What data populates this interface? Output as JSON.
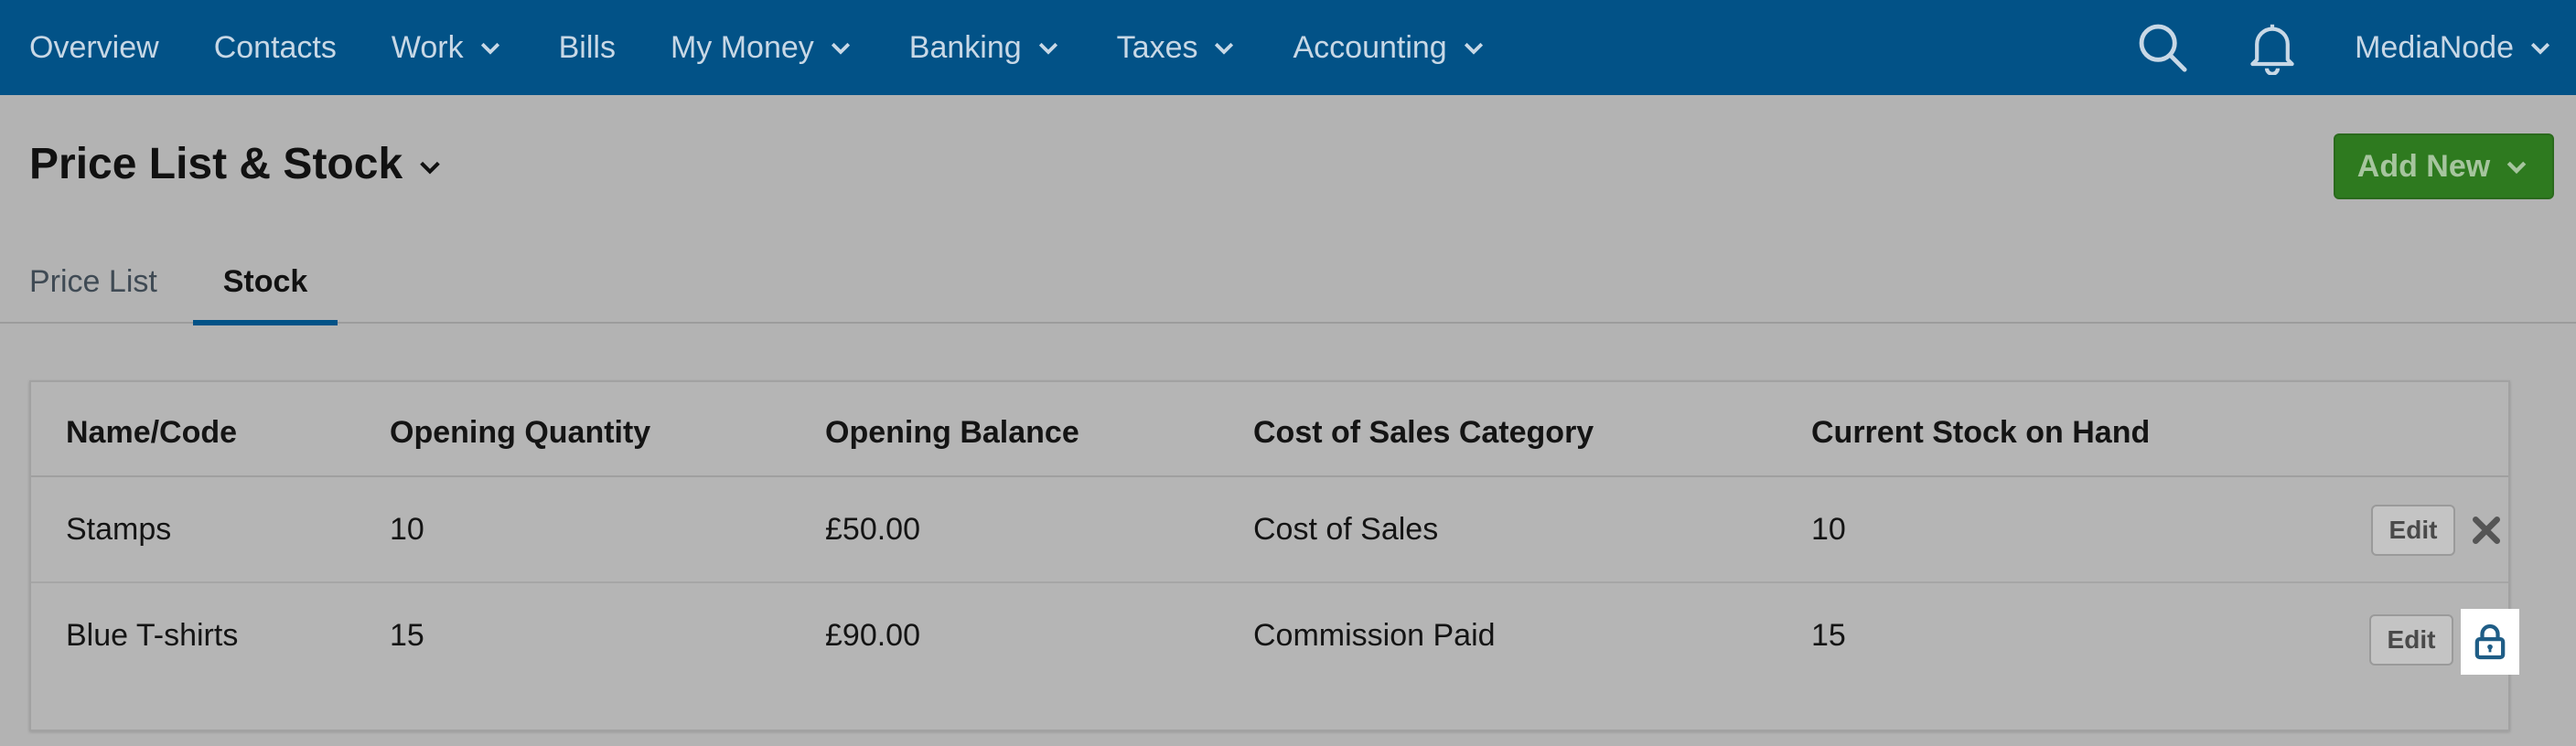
{
  "nav": {
    "items": [
      {
        "label": "Overview",
        "has_dropdown": false
      },
      {
        "label": "Contacts",
        "has_dropdown": false
      },
      {
        "label": "Work",
        "has_dropdown": true
      },
      {
        "label": "Bills",
        "has_dropdown": false
      },
      {
        "label": "My Money",
        "has_dropdown": true
      },
      {
        "label": "Banking",
        "has_dropdown": true
      },
      {
        "label": "Taxes",
        "has_dropdown": true
      },
      {
        "label": "Accounting",
        "has_dropdown": true
      }
    ],
    "search_icon": "search-icon",
    "notifications_icon": "bell-icon",
    "user_label": "MediaNode"
  },
  "header": {
    "title": "Price List & Stock",
    "add_new_label": "Add New"
  },
  "tabs": [
    {
      "label": "Price List",
      "active": false
    },
    {
      "label": "Stock",
      "active": true
    }
  ],
  "table": {
    "columns": [
      "Name/Code",
      "Opening Quantity",
      "Opening Balance",
      "Cost of Sales Category",
      "Current Stock on Hand"
    ],
    "rows": [
      {
        "name": "Stamps",
        "opening_quantity": "10",
        "opening_balance": "£50.00",
        "category": "Cost of Sales",
        "stock_on_hand": "10",
        "edit_label": "Edit",
        "action_icon": "delete-x-icon"
      },
      {
        "name": "Blue T-shirts",
        "opening_quantity": "15",
        "opening_balance": "£90.00",
        "category": "Commission Paid",
        "stock_on_hand": "15",
        "edit_label": "Edit",
        "action_icon": "lock-icon"
      }
    ]
  },
  "colors": {
    "nav_bg": "#025287",
    "add_new_bg": "#2e7a1f",
    "active_tab_underline": "#025287"
  }
}
